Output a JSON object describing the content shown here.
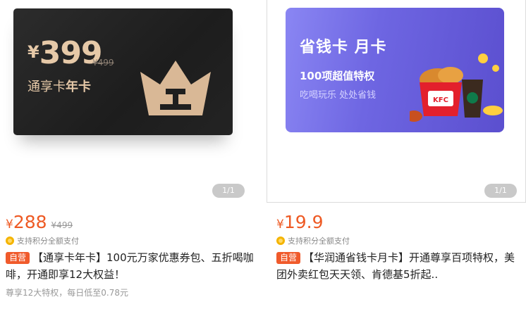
{
  "left": {
    "card": {
      "currency": "¥",
      "price": "399",
      "original": "¥499",
      "name_prefix": "通享卡",
      "name_bold": "年卡"
    },
    "pager": "1/1",
    "price": {
      "currency": "¥",
      "value": "288",
      "original": "¥499"
    },
    "points": "支持积分全额支付",
    "tag": "自营",
    "title": "【通享卡年卡】100元万家优惠券包、五折喝咖啡，开通即享12大权益！",
    "subtitle": "尊享12大特权，每日低至0.78元"
  },
  "right": {
    "card": {
      "title": "省钱卡 月卡",
      "headline": "100项超值特权",
      "slogan": "吃喝玩乐 处处省钱",
      "brand_logo": "KFC"
    },
    "pager": "1/1",
    "price": {
      "currency": "¥",
      "value": "19.9"
    },
    "points": "支持积分全额支付",
    "tag": "自营",
    "title": "【华润通省钱卡月卡】开通尊享百项特权，美团外卖红包天天领、肯德基5折起.."
  },
  "colors": {
    "accent": "#ee5a24",
    "tag_bg": "#f05a2b",
    "gold": "#e6c9a8",
    "purple": "#6e66e2"
  }
}
